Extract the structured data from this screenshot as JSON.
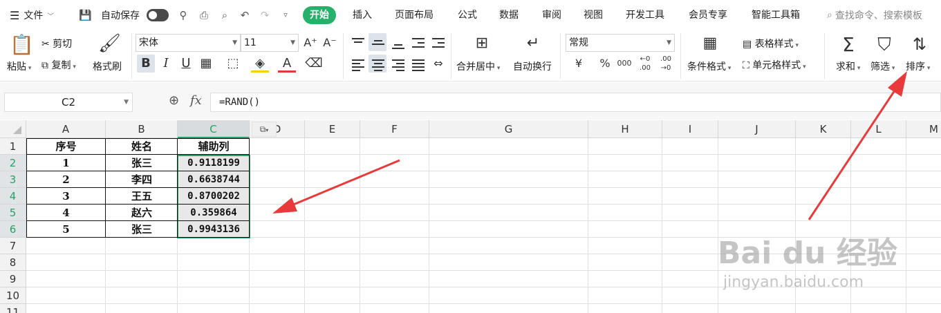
{
  "menu": {
    "file_label": "文件",
    "autosave_label": "自动保存",
    "tabs": [
      "开始",
      "插入",
      "页面布局",
      "公式",
      "数据",
      "审阅",
      "视图",
      "开发工具",
      "会员专享",
      "智能工具箱"
    ],
    "search_placeholder": "查找命令、搜索模板"
  },
  "ribbon": {
    "paste": "粘贴",
    "cut": "剪切",
    "copy": "复制",
    "format_painter": "格式刷",
    "font_name": "宋体",
    "font_size": "11",
    "merge_center": "合并居中",
    "wrap_text": "自动换行",
    "number_format": "常规",
    "conditional_format": "条件格式",
    "table_style": "表格样式",
    "cell_style": "单元格样式",
    "sum": "求和",
    "filter": "筛选",
    "sort": "排序"
  },
  "formula_bar": {
    "name_box": "C2",
    "fx": "fx",
    "formula": "=RAND()"
  },
  "columns": [
    "A",
    "B",
    "C",
    "D",
    "E",
    "F",
    "G",
    "H",
    "I",
    "J",
    "K",
    "L",
    "M"
  ],
  "rows": [
    "1",
    "2",
    "3",
    "4",
    "5",
    "6",
    "7",
    "8",
    "9",
    "10",
    "11"
  ],
  "table": {
    "headers": [
      "序号",
      "姓名",
      "辅助列"
    ],
    "rows": [
      [
        "1",
        "张三",
        "0.9118199"
      ],
      [
        "2",
        "李四",
        "0.6638744"
      ],
      [
        "3",
        "王五",
        "0.8700202"
      ],
      [
        "4",
        "赵六",
        "0.359864"
      ],
      [
        "5",
        "张三",
        "0.9943136"
      ]
    ]
  },
  "watermark": {
    "main": "Bai du 经验",
    "sub": "jingyan.baidu.com"
  },
  "colors": {
    "accent": "#25b06c",
    "selection": "#2a9d68",
    "arrow": "#e83a3a"
  }
}
